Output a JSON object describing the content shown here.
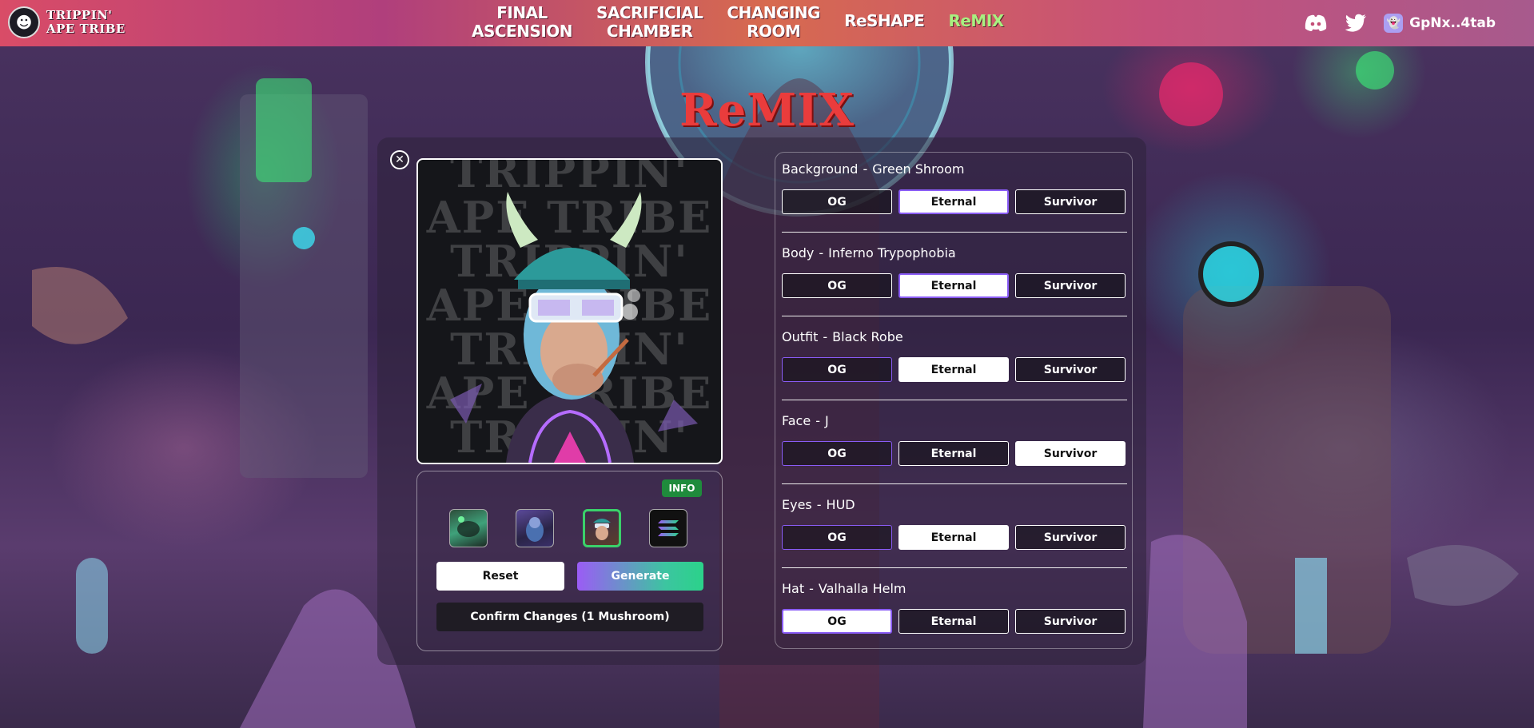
{
  "nav": {
    "logo_line1": "TRIPPIN'",
    "logo_line2": "APE TRIBE",
    "links": [
      {
        "line1": "FINAL",
        "line2": "ASCENSION"
      },
      {
        "line1": "SACRIFICIAL",
        "line2": "CHAMBER"
      },
      {
        "line1": "CHANGING",
        "line2": "ROOM"
      },
      {
        "line1": "ReSHAPE",
        "line2": ""
      },
      {
        "line1": "ReMIX",
        "line2": ""
      }
    ],
    "active_link": "ReMIX",
    "wallet": "GpNx..4tab",
    "icons": [
      "discord-icon",
      "twitter-icon",
      "phantom-wallet-icon"
    ]
  },
  "page": {
    "title": "ReMIX"
  },
  "preview": {
    "watermark_lines": [
      "TRIPPIN'",
      "APE TRIBE",
      "TRIPPIN'",
      "APE TRIBE",
      "TRIPPIN'"
    ]
  },
  "controls": {
    "info_label": "INFO",
    "thumbnails": [
      "background-option",
      "body-option",
      "ape-option",
      "solana-option"
    ],
    "selected_thumbnail": 2,
    "reset_label": "Reset",
    "generate_label": "Generate",
    "confirm_label": "Confirm Changes (1 Mushroom)"
  },
  "traits": [
    {
      "name": "Background",
      "value": "Green Shroom",
      "selected": "Eternal"
    },
    {
      "name": "Body",
      "value": "Inferno Trypophobia",
      "selected": "Eternal"
    },
    {
      "name": "Outfit",
      "value": "Black Robe",
      "selected": "OG"
    },
    {
      "name": "Face",
      "value": "J",
      "selected": "Survivor"
    },
    {
      "name": "Eyes",
      "value": "HUD",
      "selected": "OG"
    },
    {
      "name": "Hat",
      "value": "Valhalla Helm",
      "selected": "OG"
    }
  ],
  "option_labels": [
    "OG",
    "Eternal",
    "Survivor"
  ],
  "colors": {
    "accent_green": "#a8f080",
    "title_red": "#ea3c3c",
    "select_outline": "#8a5cf6",
    "info_green": "#1f8b3c"
  }
}
